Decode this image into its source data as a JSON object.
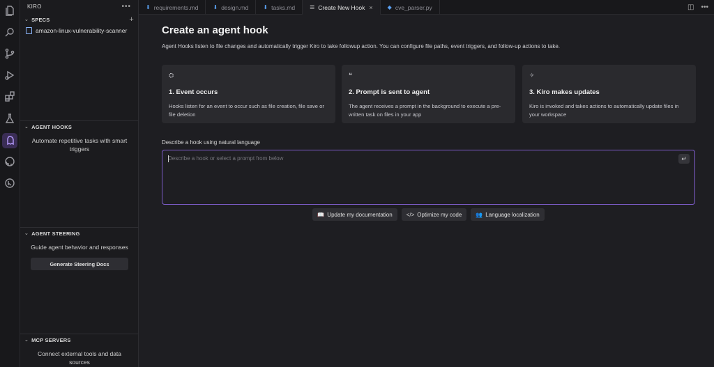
{
  "sidebar": {
    "title": "KIRO",
    "menu_icon": "more-horizontal-icon",
    "specs": {
      "header": "SPECS",
      "items": [
        {
          "label": "amazon-linux-vulnerability-scanner"
        }
      ]
    },
    "agent_hooks": {
      "header": "AGENT HOOKS",
      "text": "Automate repetitive tasks with smart triggers"
    },
    "agent_steering": {
      "header": "AGENT STEERING",
      "text": "Guide agent behavior and responses",
      "button": "Generate Steering Docs"
    },
    "mcp_servers": {
      "header": "MCP SERVERS",
      "text": "Connect external tools and data sources"
    }
  },
  "tabs": [
    {
      "label": "requirements.md",
      "icon": "markdown-icon"
    },
    {
      "label": "design.md",
      "icon": "markdown-icon"
    },
    {
      "label": "tasks.md",
      "icon": "markdown-icon"
    },
    {
      "label": "Create New Hook",
      "icon": "hook-icon",
      "active": true
    },
    {
      "label": "cve_parser.py",
      "icon": "python-icon"
    }
  ],
  "main": {
    "title": "Create an agent hook",
    "description": "Agent Hooks listen to file changes and automatically trigger Kiro to take followup action. You can configure file paths, event triggers, and follow-up actions to take.",
    "cards": [
      {
        "title": "1. Event occurs",
        "body": "Hooks listen for an event to occur such as file creation, file save or file deletion",
        "icon": "event-icon"
      },
      {
        "title": "2. Prompt is sent to agent",
        "body": "The agent receives a prompt in the background to execute a pre-written task on files in your app",
        "icon": "quote-icon"
      },
      {
        "title": "3. Kiro makes updates",
        "body": "Kiro is invoked and takes actions to automatically update files in your workspace",
        "icon": "sparkle-icon"
      }
    ],
    "input_label": "Describe a hook using natural language",
    "input_placeholder": "Describe a hook or select a prompt from below",
    "input_value": "",
    "suggestions": [
      {
        "label": "Update my documentation",
        "icon": "book-icon"
      },
      {
        "label": "Optimize my code",
        "icon": "code-icon"
      },
      {
        "label": "Language localization",
        "icon": "people-icon"
      }
    ]
  }
}
